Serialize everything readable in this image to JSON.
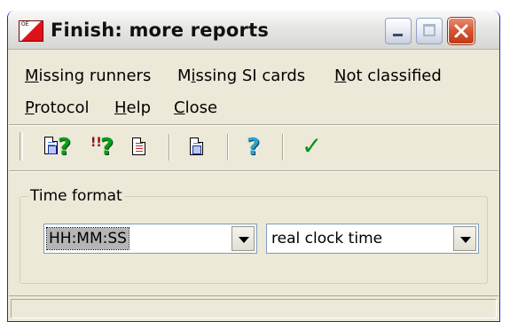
{
  "window": {
    "title": "Finish: more reports",
    "icon_label": "OE",
    "controls": {
      "minimize": "minimize-icon",
      "maximize": "maximize-icon",
      "close": "close-icon"
    }
  },
  "menu": {
    "row1": [
      {
        "label": "Missing runners",
        "mnemonic": "M"
      },
      {
        "label": "Missing SI cards",
        "mnemonic": "i"
      },
      {
        "label": "Not classified",
        "mnemonic": "N"
      }
    ],
    "row2": [
      {
        "label": "Protocol",
        "mnemonic": "P"
      },
      {
        "label": "Help",
        "mnemonic": "H"
      },
      {
        "label": "Close",
        "mnemonic": "C"
      }
    ]
  },
  "toolbar": {
    "buttons": [
      {
        "icon": "document-question-icon"
      },
      {
        "icon": "multi-question-icon"
      },
      {
        "icon": "report-document-icon"
      },
      {
        "icon": "preview-document-icon"
      },
      {
        "icon": "help-question-icon"
      },
      {
        "icon": "checkmark-icon"
      }
    ],
    "bangs": "!!",
    "question": "?",
    "check": "✓"
  },
  "time_format": {
    "legend": "Time format",
    "format_select": {
      "value": "HH:MM:SS"
    },
    "mode_select": {
      "value": "real clock time"
    }
  },
  "colors": {
    "window_bg": "#ece9d8",
    "border_blue": "#0831d9",
    "close_red": "#c0391a",
    "check_green": "#0e8f1e"
  }
}
